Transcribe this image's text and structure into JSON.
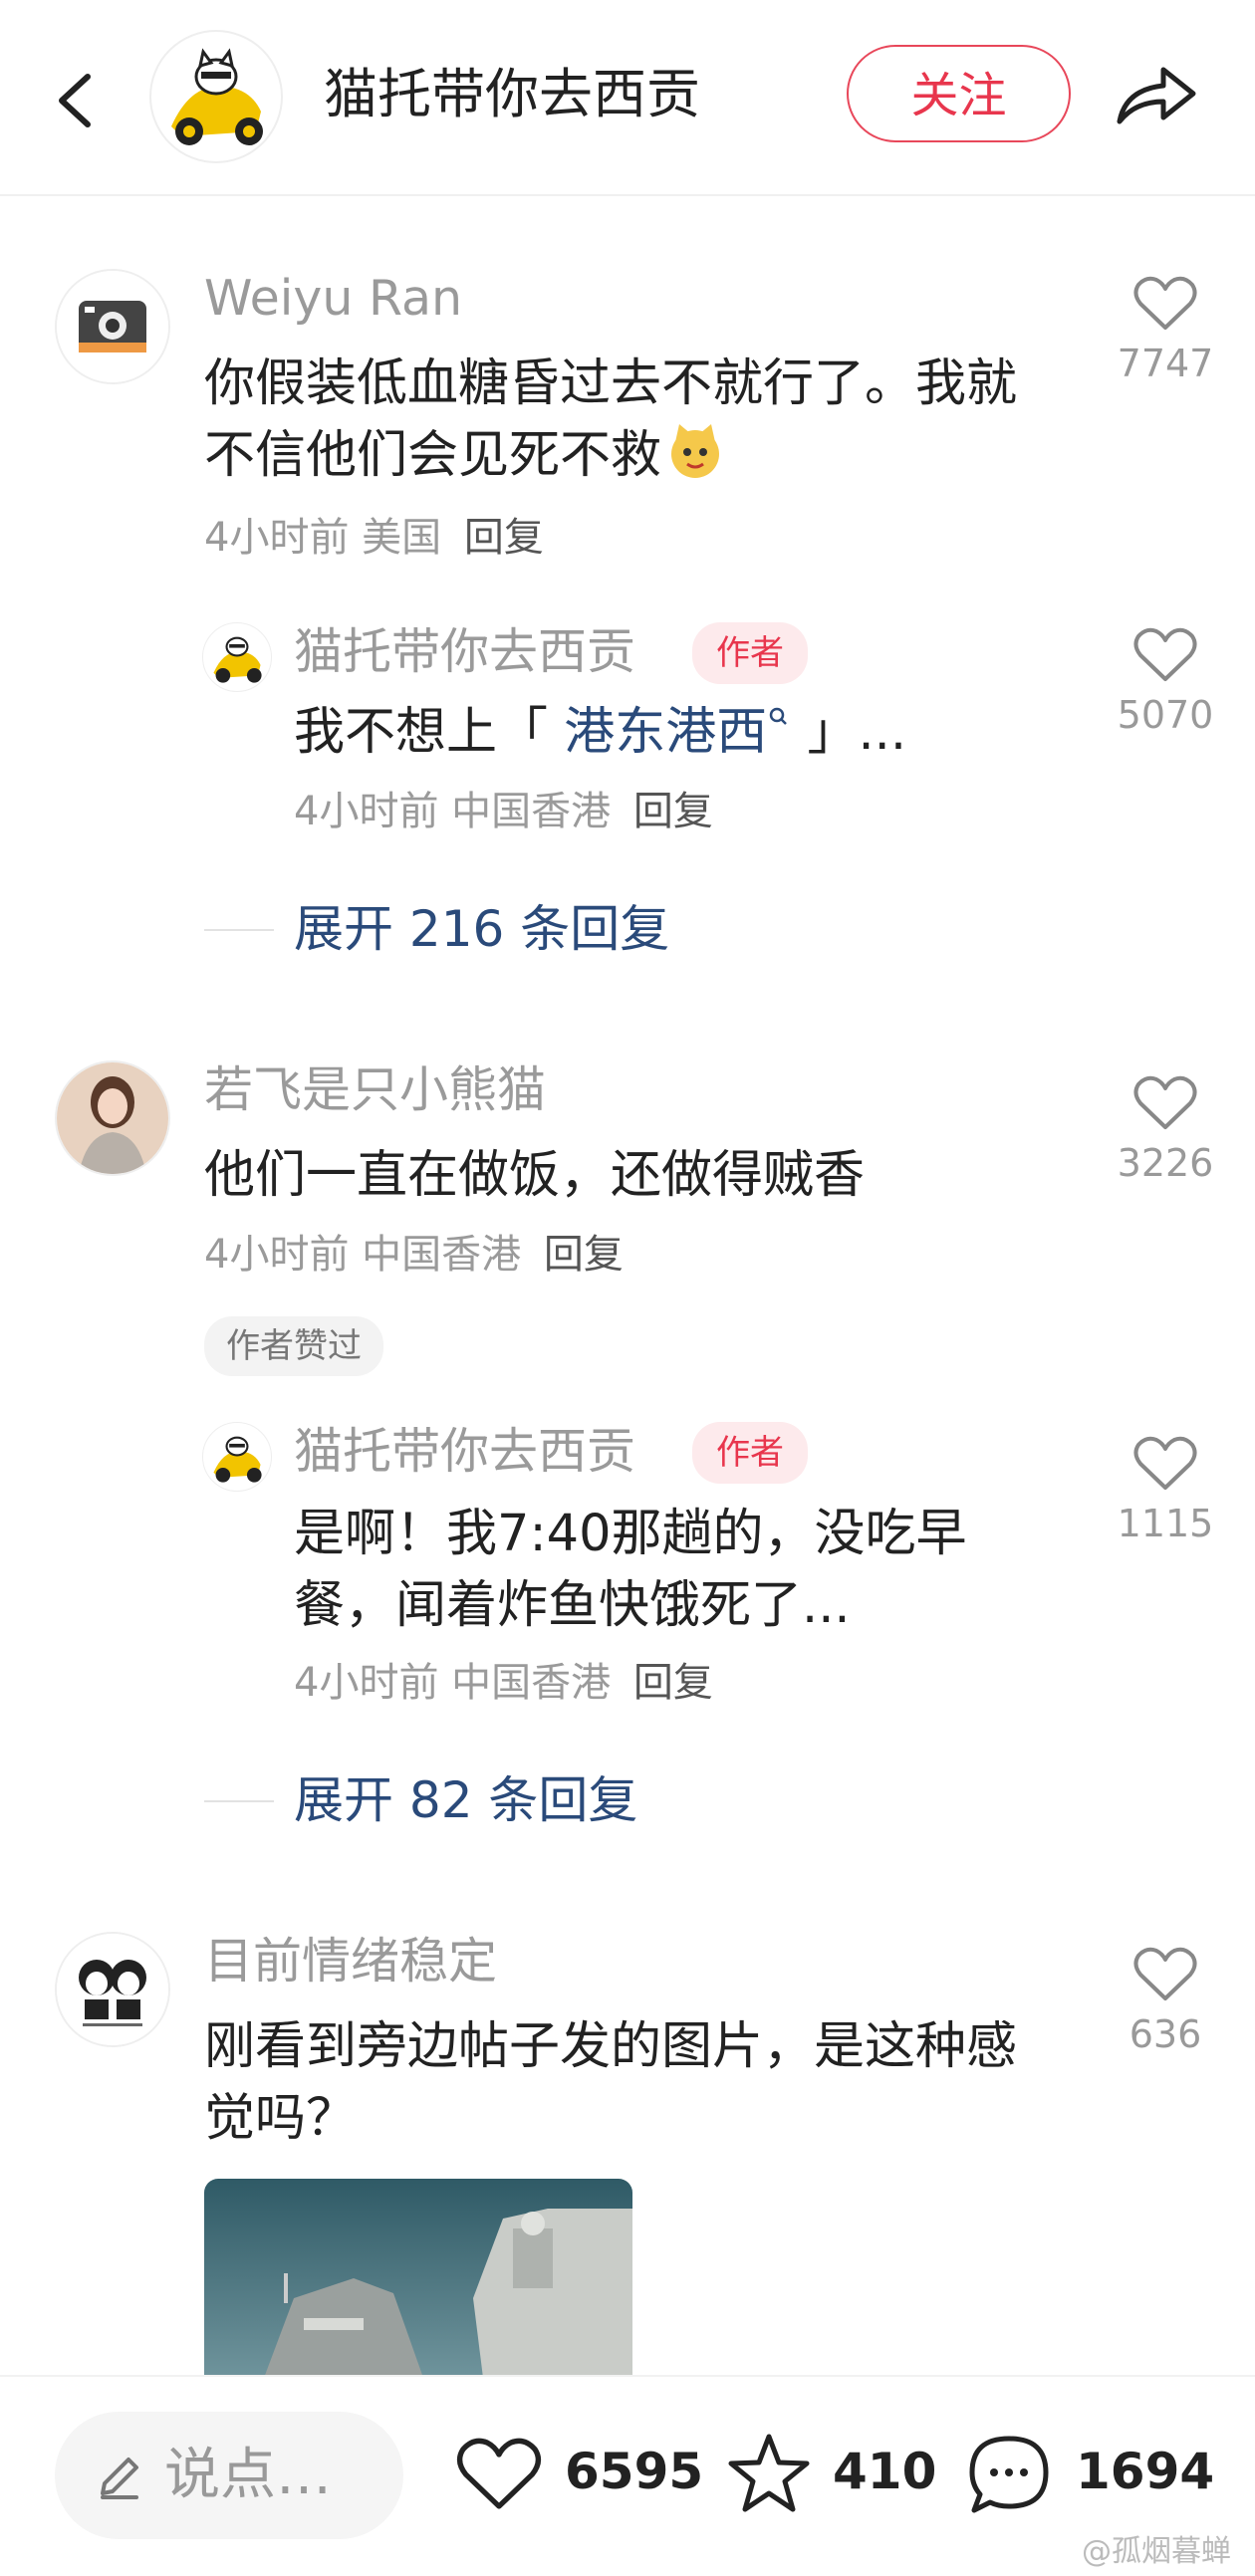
{
  "header": {
    "title": "猫托带你去西贡",
    "follow_label": "关注"
  },
  "comments": [
    {
      "user": "Weiyu Ran",
      "text": "你假装低血糖昏过去不就行了。我就不信他们会见死不救",
      "emoji": "😸",
      "time": "4小时前",
      "location": "美国",
      "reply_label": "回复",
      "likes": "7747",
      "replies": [
        {
          "user": "猫托带你去西贡",
          "tag": "作者",
          "text_prefix": "我不想上「",
          "link_text": "港东港西",
          "text_suffix": "」...",
          "time": "4小时前",
          "location": "中国香港",
          "reply_label": "回复",
          "likes": "5070"
        }
      ],
      "expand_label": "展开 216 条回复"
    },
    {
      "user": "若飞是只小熊猫",
      "text": "他们一直在做饭，还做得贼香",
      "time": "4小时前",
      "location": "中国香港",
      "reply_label": "回复",
      "likes": "3226",
      "badge": "作者赞过",
      "replies": [
        {
          "user": "猫托带你去西贡",
          "tag": "作者",
          "text": "是啊！我7:40那趟的，没吃早餐，闻着炸鱼快饿死了...",
          "time": "4小时前",
          "location": "中国香港",
          "reply_label": "回复",
          "likes": "1115"
        }
      ],
      "expand_label": "展开 82 条回复"
    },
    {
      "user": "目前情绪稳定",
      "text": "刚看到旁边帖子发的图片，是这种感觉吗？",
      "likes": "636"
    }
  ],
  "bottom_bar": {
    "input_placeholder": "说点…",
    "likes": "6595",
    "favorites": "410",
    "comments": "1694"
  },
  "watermark": "@孤烟暮蝉",
  "colors": {
    "accent": "#e8364d",
    "link": "#2a4a7a",
    "meta": "#9a9a9a"
  },
  "icons": [
    "back-arrow-icon",
    "share-icon",
    "heart-icon",
    "star-icon",
    "comment-icon",
    "pencil-icon",
    "link-search-icon"
  ]
}
